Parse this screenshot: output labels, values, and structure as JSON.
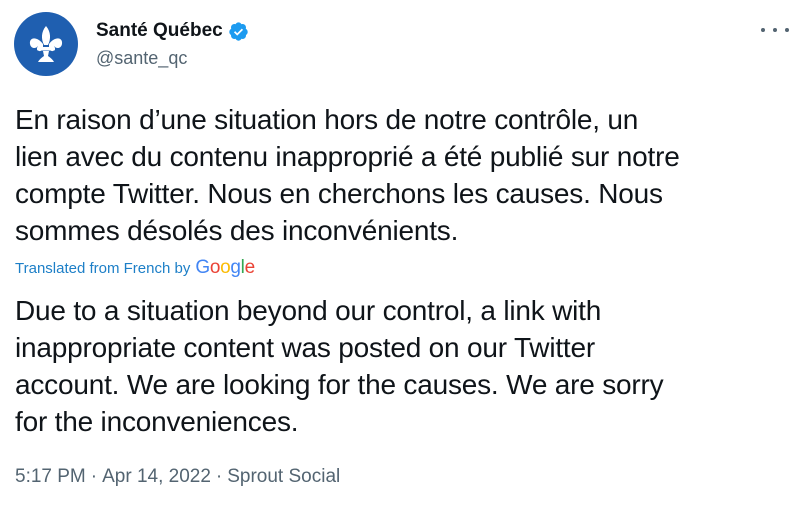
{
  "account": {
    "display_name": "Santé Québec",
    "handle": "@sante_qc",
    "avatar_icon": "fleur-de-lis-icon",
    "avatar_color": "#1f5fb0",
    "verified_icon": "verified-badge-icon",
    "verified_color": "#1d9bf0"
  },
  "menu": {
    "icon": "more-options-icon"
  },
  "tweet": {
    "original_lines": [
      "En raison d’une situation hors de notre contrôle, un",
      "lien avec du contenu inapproprié a été publié sur notre",
      "compte Twitter. Nous en cherchons les causes. Nous",
      "sommes désolés des inconvénients."
    ],
    "translated_label": "Translated from French by",
    "translation_provider": "Google",
    "translated_lines": [
      "Due to a situation beyond our control, a link with",
      "inappropriate content was posted on our Twitter",
      "account. We are looking for the causes. We are sorry",
      "for the inconveniences."
    ],
    "time": "5:17 PM",
    "date": "Apr 14, 2022",
    "source": "Sprout Social",
    "separator": "·",
    "link_color": "#1d7fc7"
  }
}
